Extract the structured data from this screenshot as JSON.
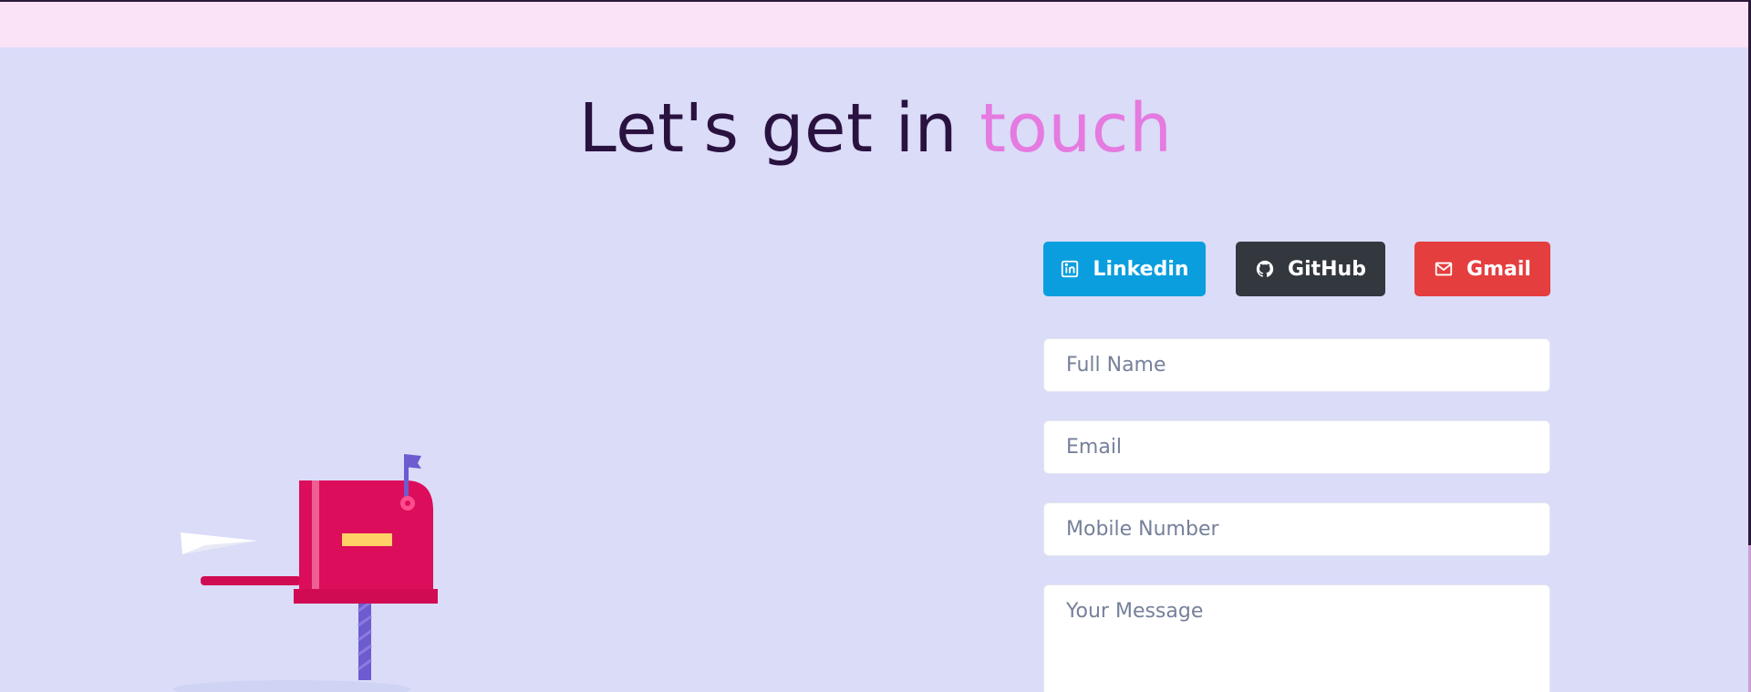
{
  "heading": {
    "prefix": "Let's get in",
    "accent": "touch",
    "accent_color": "#e57ae0"
  },
  "social": {
    "linkedin": {
      "label": "Linkedin",
      "icon": "linkedin-icon",
      "color": "#0a9edf"
    },
    "github": {
      "label": "GitHub",
      "icon": "github-icon",
      "color": "#33383f"
    },
    "gmail": {
      "label": "Gmail",
      "icon": "mail-icon",
      "color": "#e53e3e"
    }
  },
  "form": {
    "full_name_placeholder": "Full Name",
    "email_placeholder": "Email",
    "mobile_placeholder": "Mobile Number",
    "message_placeholder": "Your Message"
  },
  "illustration": {
    "name": "mailbox-illustration"
  }
}
